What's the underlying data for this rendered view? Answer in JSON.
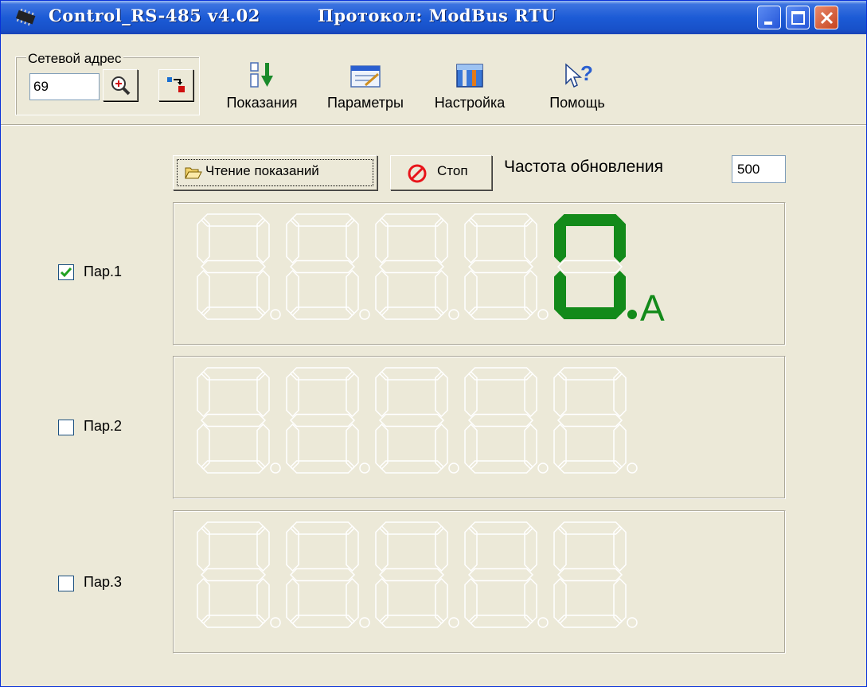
{
  "window": {
    "title": "Control_RS-485 v4.02",
    "protocol_label": "Протокол: ModBus RTU"
  },
  "toolbar": {
    "address_group_label": "Сетевой адрес",
    "address_value": "69",
    "buttons": [
      {
        "label": "Показания",
        "icon": "readings-icon"
      },
      {
        "label": "Параметры",
        "icon": "parameters-icon"
      },
      {
        "label": "Настройка",
        "icon": "settings-icon"
      },
      {
        "label": "Помощь",
        "icon": "help-icon"
      }
    ]
  },
  "controls": {
    "read_button_label": "Чтение показаний",
    "stop_button_label": "Стоп",
    "refresh_label": "Частота обновления",
    "refresh_value": "500"
  },
  "params": [
    {
      "label": "Пар.1",
      "checked": true,
      "digits": [
        "",
        "",
        "",
        "",
        "0"
      ],
      "unit": "A"
    },
    {
      "label": "Пар.2",
      "checked": false,
      "digits": [
        "",
        "",
        "",
        "",
        ""
      ],
      "unit": ""
    },
    {
      "label": "Пар.3",
      "checked": false,
      "digits": [
        "",
        "",
        "",
        "",
        ""
      ],
      "unit": ""
    }
  ],
  "colors": {
    "titlebar": "#1c5bd6",
    "face": "#ece9d8",
    "active_segment": "#138a1a",
    "inactive_segment": "#ffffff",
    "stop_icon": "#e8141a"
  }
}
